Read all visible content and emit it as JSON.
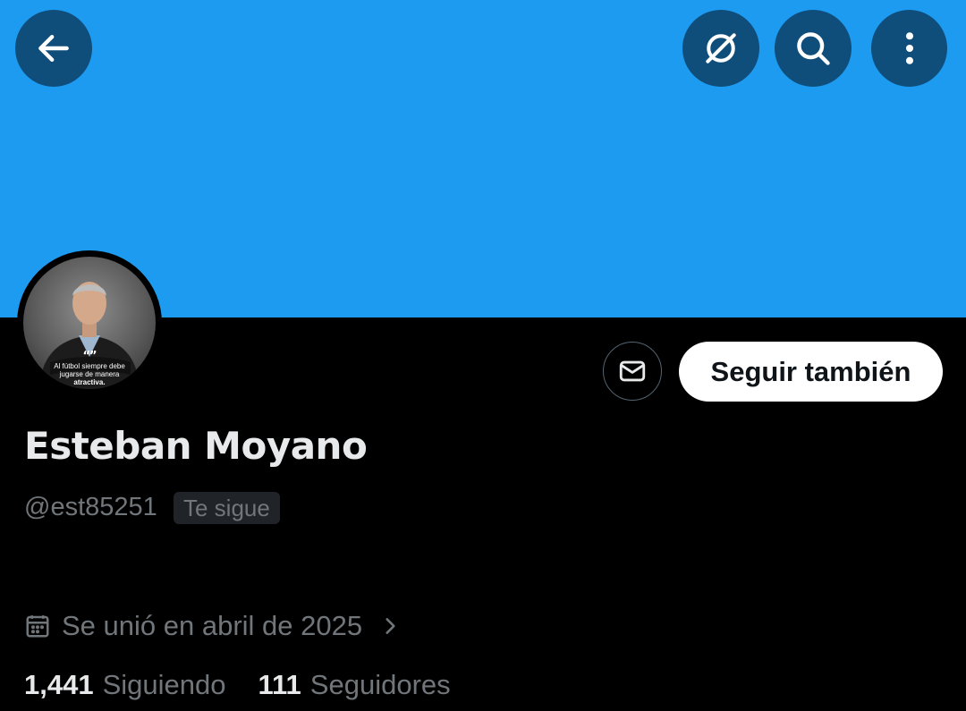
{
  "colors": {
    "banner": "#1d9bf0",
    "top_button_bg": "#0f4d7b",
    "background": "#000000",
    "primary_text": "#e7e9ea",
    "secondary_text": "#71767b",
    "follow_button_bg": "#ffffff",
    "follow_button_text": "#0f1419"
  },
  "header": {
    "back_icon": "arrow-left-icon",
    "grok_icon": "grok-icon",
    "search_icon": "search-icon",
    "more_icon": "more-vertical-icon"
  },
  "avatar": {
    "quote_mark": "“”",
    "quote_lines": [
      "Al fútbol siempre debe",
      "jugarse de manera",
      "atractiva."
    ]
  },
  "actions": {
    "message_icon": "mail-icon",
    "follow_label": "Seguir también"
  },
  "profile": {
    "name": "Esteban Moyano",
    "handle": "@est85251",
    "follows_you": "Te sigue",
    "joined": "Se unió en abril de 2025"
  },
  "stats": {
    "following_count": "1,441",
    "following_label": "Siguiendo",
    "followers_count": "111",
    "followers_label": "Seguidores"
  }
}
